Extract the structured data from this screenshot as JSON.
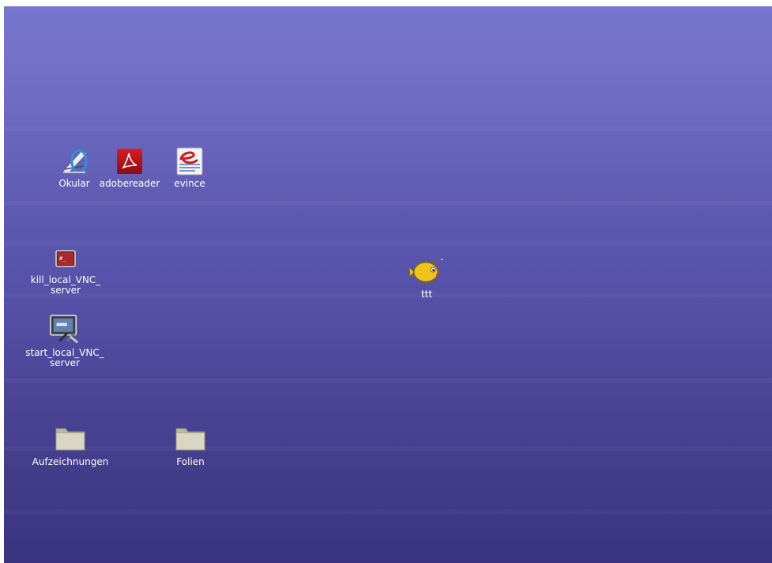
{
  "desktop": {
    "background_top": "#7676cf",
    "background_bottom": "#3b3380",
    "icons": {
      "okular": {
        "label": "Okular",
        "icon": "okular-icon"
      },
      "adobereader": {
        "label": "adobereader",
        "icon": "adobe-reader-icon",
        "color": "#b3121a"
      },
      "evince": {
        "label": "evince",
        "icon": "evince-icon",
        "color": "#cc1f1f"
      },
      "kill_vnc": {
        "line1": "kill_local_VNC_",
        "line2": "server",
        "icon": "terminal-icon"
      },
      "start_vnc": {
        "line1": "start_local_VNC_",
        "line2": "server",
        "icon": "monitor-tools-icon"
      },
      "ttt": {
        "label": "ttt",
        "icon": "pufferfish-icon"
      },
      "aufzeichnungen": {
        "label": "Aufzeichnungen",
        "icon": "folder-icon"
      },
      "folien": {
        "label": "Folien",
        "icon": "folder-icon"
      }
    }
  }
}
